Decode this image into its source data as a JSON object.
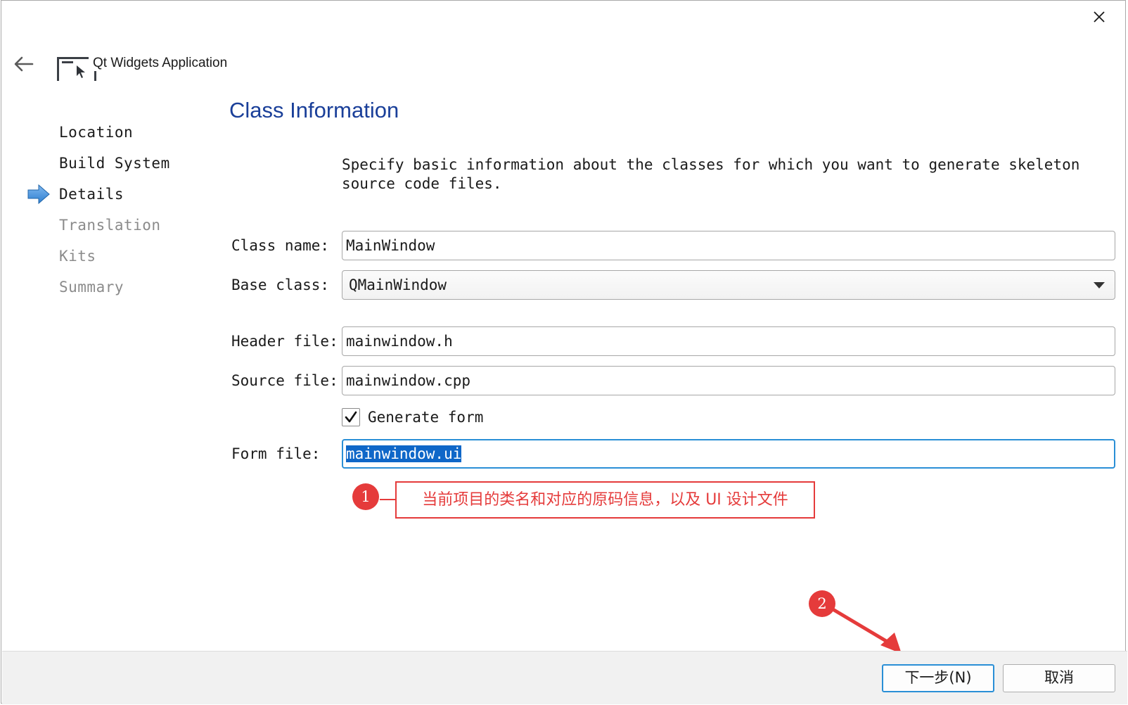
{
  "window": {
    "title": "Qt Widgets Application"
  },
  "steps": [
    {
      "label": "Location",
      "state": "done"
    },
    {
      "label": "Build System",
      "state": "done"
    },
    {
      "label": "Details",
      "state": "current"
    },
    {
      "label": "Translation",
      "state": "pending"
    },
    {
      "label": "Kits",
      "state": "pending"
    },
    {
      "label": "Summary",
      "state": "pending"
    }
  ],
  "page": {
    "title": "Class Information",
    "description": "Specify basic information about the classes for which you want to generate skeleton source code files."
  },
  "form": {
    "class_name_label": "Class name:",
    "class_name_value": "MainWindow",
    "base_class_label": "Base class:",
    "base_class_value": "QMainWindow",
    "header_file_label": "Header file:",
    "header_file_value": "mainwindow.h",
    "source_file_label": "Source file:",
    "source_file_value": "mainwindow.cpp",
    "generate_form_label": "Generate form",
    "generate_form_checked": true,
    "form_file_label": "Form file:",
    "form_file_value": "mainwindow.ui"
  },
  "annotations": {
    "callout1_number": "1",
    "callout1_text": "当前项目的类名和对应的原码信息，以及 UI 设计文件",
    "callout2_number": "2",
    "color": "#e53b3b"
  },
  "buttons": {
    "next_label": "下一步(N)",
    "cancel_label": "取消"
  },
  "icons": {
    "back": "back-arrow-icon",
    "close": "close-icon",
    "current_step": "step-arrow-icon",
    "app": "qt-widgets-app-icon",
    "check": "checkmark-icon"
  }
}
